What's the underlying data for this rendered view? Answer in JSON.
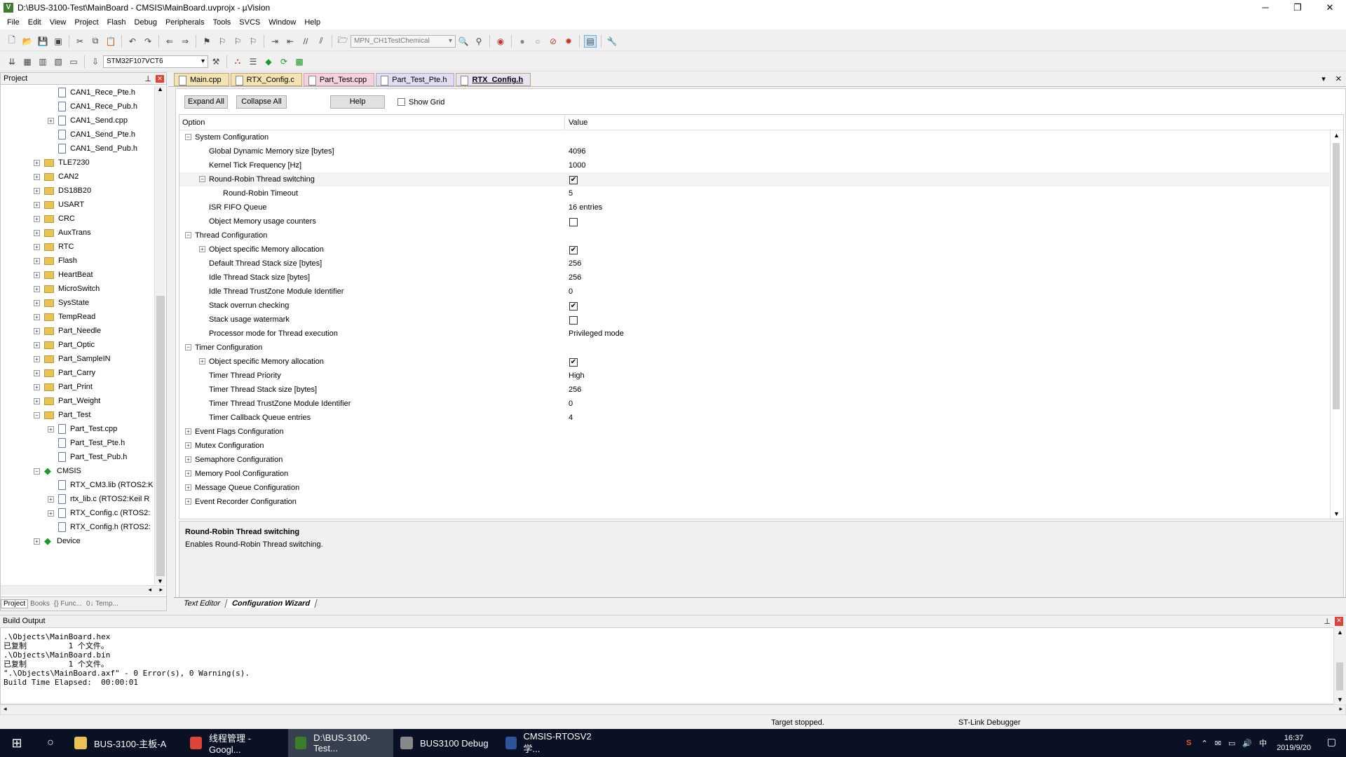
{
  "window": {
    "title": "D:\\BUS-3100-Test\\MainBoard - CMSIS\\MainBoard.uvprojx - µVision",
    "min": "─",
    "max": "❐",
    "close": "✕"
  },
  "menu": [
    "File",
    "Edit",
    "View",
    "Project",
    "Flash",
    "Debug",
    "Peripherals",
    "Tools",
    "SVCS",
    "Window",
    "Help"
  ],
  "toolbar1": {
    "target_combo": "MPN_CH1TestChemical"
  },
  "toolbar2": {
    "device_combo": "STM32F107VCT6"
  },
  "project_panel": {
    "title": "Project",
    "tree": [
      {
        "label": "CAN1_Rece_Pte.h",
        "type": "file",
        "level": 2,
        "exp": ""
      },
      {
        "label": "CAN1_Rece_Pub.h",
        "type": "file",
        "level": 2,
        "exp": ""
      },
      {
        "label": "CAN1_Send.cpp",
        "type": "file",
        "level": 2,
        "exp": "+"
      },
      {
        "label": "CAN1_Send_Pte.h",
        "type": "file",
        "level": 2,
        "exp": ""
      },
      {
        "label": "CAN1_Send_Pub.h",
        "type": "file",
        "level": 2,
        "exp": ""
      },
      {
        "label": "TLE7230",
        "type": "folder",
        "level": 1,
        "exp": "+"
      },
      {
        "label": "CAN2",
        "type": "folder",
        "level": 1,
        "exp": "+"
      },
      {
        "label": "DS18B20",
        "type": "folder",
        "level": 1,
        "exp": "+"
      },
      {
        "label": "USART",
        "type": "folder",
        "level": 1,
        "exp": "+"
      },
      {
        "label": "CRC",
        "type": "folder",
        "level": 1,
        "exp": "+"
      },
      {
        "label": "AuxTrans",
        "type": "folder",
        "level": 1,
        "exp": "+"
      },
      {
        "label": "RTC",
        "type": "folder",
        "level": 1,
        "exp": "+"
      },
      {
        "label": "Flash",
        "type": "folder",
        "level": 1,
        "exp": "+"
      },
      {
        "label": "HeartBeat",
        "type": "folder",
        "level": 1,
        "exp": "+"
      },
      {
        "label": "MicroSwitch",
        "type": "folder",
        "level": 1,
        "exp": "+"
      },
      {
        "label": "SysState",
        "type": "folder",
        "level": 1,
        "exp": "+"
      },
      {
        "label": "TempRead",
        "type": "folder",
        "level": 1,
        "exp": "+"
      },
      {
        "label": "Part_Needle",
        "type": "folder",
        "level": 1,
        "exp": "+"
      },
      {
        "label": "Part_Optic",
        "type": "folder",
        "level": 1,
        "exp": "+"
      },
      {
        "label": "Part_SampleIN",
        "type": "folder",
        "level": 1,
        "exp": "+"
      },
      {
        "label": "Part_Carry",
        "type": "folder",
        "level": 1,
        "exp": "+"
      },
      {
        "label": "Part_Print",
        "type": "folder",
        "level": 1,
        "exp": "+"
      },
      {
        "label": "Part_Weight",
        "type": "folder",
        "level": 1,
        "exp": "+"
      },
      {
        "label": "Part_Test",
        "type": "folder",
        "level": 1,
        "exp": "−"
      },
      {
        "label": "Part_Test.cpp",
        "type": "file",
        "level": 2,
        "exp": "+"
      },
      {
        "label": "Part_Test_Pte.h",
        "type": "file",
        "level": 2,
        "exp": ""
      },
      {
        "label": "Part_Test_Pub.h",
        "type": "file",
        "level": 2,
        "exp": ""
      },
      {
        "label": "CMSIS",
        "type": "diamond",
        "level": 1,
        "exp": "−"
      },
      {
        "label": "RTX_CM3.lib (RTOS2:K",
        "type": "file",
        "level": 2,
        "exp": ""
      },
      {
        "label": "rtx_lib.c (RTOS2:Keil R",
        "type": "file",
        "level": 2,
        "exp": "+"
      },
      {
        "label": "RTX_Config.c (RTOS2:",
        "type": "file",
        "level": 2,
        "exp": "+"
      },
      {
        "label": "RTX_Config.h (RTOS2:",
        "type": "file",
        "level": 2,
        "exp": ""
      },
      {
        "label": "Device",
        "type": "diamond",
        "level": 1,
        "exp": "+"
      }
    ],
    "tabs": [
      "Project",
      "Books",
      "{} Func...",
      "0↓ Temp..."
    ]
  },
  "editor_tabs": [
    {
      "label": "Main.cpp",
      "style": "yellow"
    },
    {
      "label": "RTX_Config.c",
      "style": "yellow"
    },
    {
      "label": "Part_Test.cpp",
      "style": "pink"
    },
    {
      "label": "Part_Test_Pte.h",
      "style": "lav"
    },
    {
      "label": "RTX_Config.h",
      "style": "act"
    }
  ],
  "wizard": {
    "expand_all": "Expand All",
    "collapse_all": "Collapse All",
    "help": "Help",
    "show_grid": "Show Grid",
    "col_option": "Option",
    "col_value": "Value",
    "rows": [
      {
        "label": "System Configuration",
        "indent": 0,
        "exp": "−",
        "value": "",
        "check": null
      },
      {
        "label": "Global Dynamic Memory size [bytes]",
        "indent": 1,
        "exp": "",
        "value": "4096",
        "check": null
      },
      {
        "label": "Kernel Tick Frequency [Hz]",
        "indent": 1,
        "exp": "",
        "value": "1000",
        "check": null
      },
      {
        "label": "Round-Robin Thread switching",
        "indent": 1,
        "exp": "−",
        "value": "",
        "check": true,
        "selected": true
      },
      {
        "label": "Round-Robin Timeout",
        "indent": 2,
        "exp": "",
        "value": "5",
        "check": null
      },
      {
        "label": "ISR FIFO Queue",
        "indent": 1,
        "exp": "",
        "value": "16 entries",
        "check": null
      },
      {
        "label": "Object Memory usage counters",
        "indent": 1,
        "exp": "",
        "value": "",
        "check": false
      },
      {
        "label": "Thread Configuration",
        "indent": 0,
        "exp": "−",
        "value": "",
        "check": null
      },
      {
        "label": "Object specific Memory allocation",
        "indent": 1,
        "exp": "+",
        "value": "",
        "check": true
      },
      {
        "label": "Default Thread Stack size [bytes]",
        "indent": 1,
        "exp": "",
        "value": "256",
        "check": null
      },
      {
        "label": "Idle Thread Stack size [bytes]",
        "indent": 1,
        "exp": "",
        "value": "256",
        "check": null
      },
      {
        "label": "Idle Thread TrustZone Module Identifier",
        "indent": 1,
        "exp": "",
        "value": "0",
        "check": null
      },
      {
        "label": "Stack overrun checking",
        "indent": 1,
        "exp": "",
        "value": "",
        "check": true
      },
      {
        "label": "Stack usage watermark",
        "indent": 1,
        "exp": "",
        "value": "",
        "check": false
      },
      {
        "label": "Processor mode for Thread execution",
        "indent": 1,
        "exp": "",
        "value": "Privileged mode",
        "check": null
      },
      {
        "label": "Timer Configuration",
        "indent": 0,
        "exp": "−",
        "value": "",
        "check": null
      },
      {
        "label": "Object specific Memory allocation",
        "indent": 1,
        "exp": "+",
        "value": "",
        "check": true
      },
      {
        "label": "Timer Thread Priority",
        "indent": 1,
        "exp": "",
        "value": "High",
        "check": null
      },
      {
        "label": "Timer Thread Stack size [bytes]",
        "indent": 1,
        "exp": "",
        "value": "256",
        "check": null
      },
      {
        "label": "Timer Thread TrustZone Module Identifier",
        "indent": 1,
        "exp": "",
        "value": "0",
        "check": null
      },
      {
        "label": "Timer Callback Queue entries",
        "indent": 1,
        "exp": "",
        "value": "4",
        "check": null
      },
      {
        "label": "Event Flags Configuration",
        "indent": 0,
        "exp": "+",
        "value": "",
        "check": null
      },
      {
        "label": "Mutex Configuration",
        "indent": 0,
        "exp": "+",
        "value": "",
        "check": null
      },
      {
        "label": "Semaphore Configuration",
        "indent": 0,
        "exp": "+",
        "value": "",
        "check": null
      },
      {
        "label": "Memory Pool Configuration",
        "indent": 0,
        "exp": "+",
        "value": "",
        "check": null
      },
      {
        "label": "Message Queue Configuration",
        "indent": 0,
        "exp": "+",
        "value": "",
        "check": null
      },
      {
        "label": "Event Recorder Configuration",
        "indent": 0,
        "exp": "+",
        "value": "",
        "check": null
      }
    ],
    "help_title": "Round-Robin Thread switching",
    "help_text": "Enables Round-Robin Thread switching.",
    "bottom_tabs": [
      "Text Editor",
      "Configuration Wizard"
    ]
  },
  "build_output": {
    "title": "Build Output",
    "text": ".\\Objects\\MainBoard.hex\n已复制         1 个文件。\n.\\Objects\\MainBoard.bin\n已复制         1 个文件。\n\".\\Objects\\MainBoard.axf\" - 0 Error(s), 0 Warning(s).\nBuild Time Elapsed:  00:00:01"
  },
  "status": {
    "state": "Target stopped.",
    "debugger": "ST-Link Debugger"
  },
  "taskbar": {
    "items": [
      {
        "label": "BUS-3100-主板-A",
        "color": "#e8c253"
      },
      {
        "label": "线程管理 - Googl...",
        "color": "#db4437"
      },
      {
        "label": "D:\\BUS-3100-Test...",
        "color": "#3a7d2a",
        "active": true
      },
      {
        "label": "BUS3100 Debug",
        "color": "#888888"
      },
      {
        "label": "CMSIS-RTOSV2学...",
        "color": "#2b579a"
      }
    ],
    "time": "16:37",
    "date": "2019/9/20",
    "ime": "中"
  }
}
